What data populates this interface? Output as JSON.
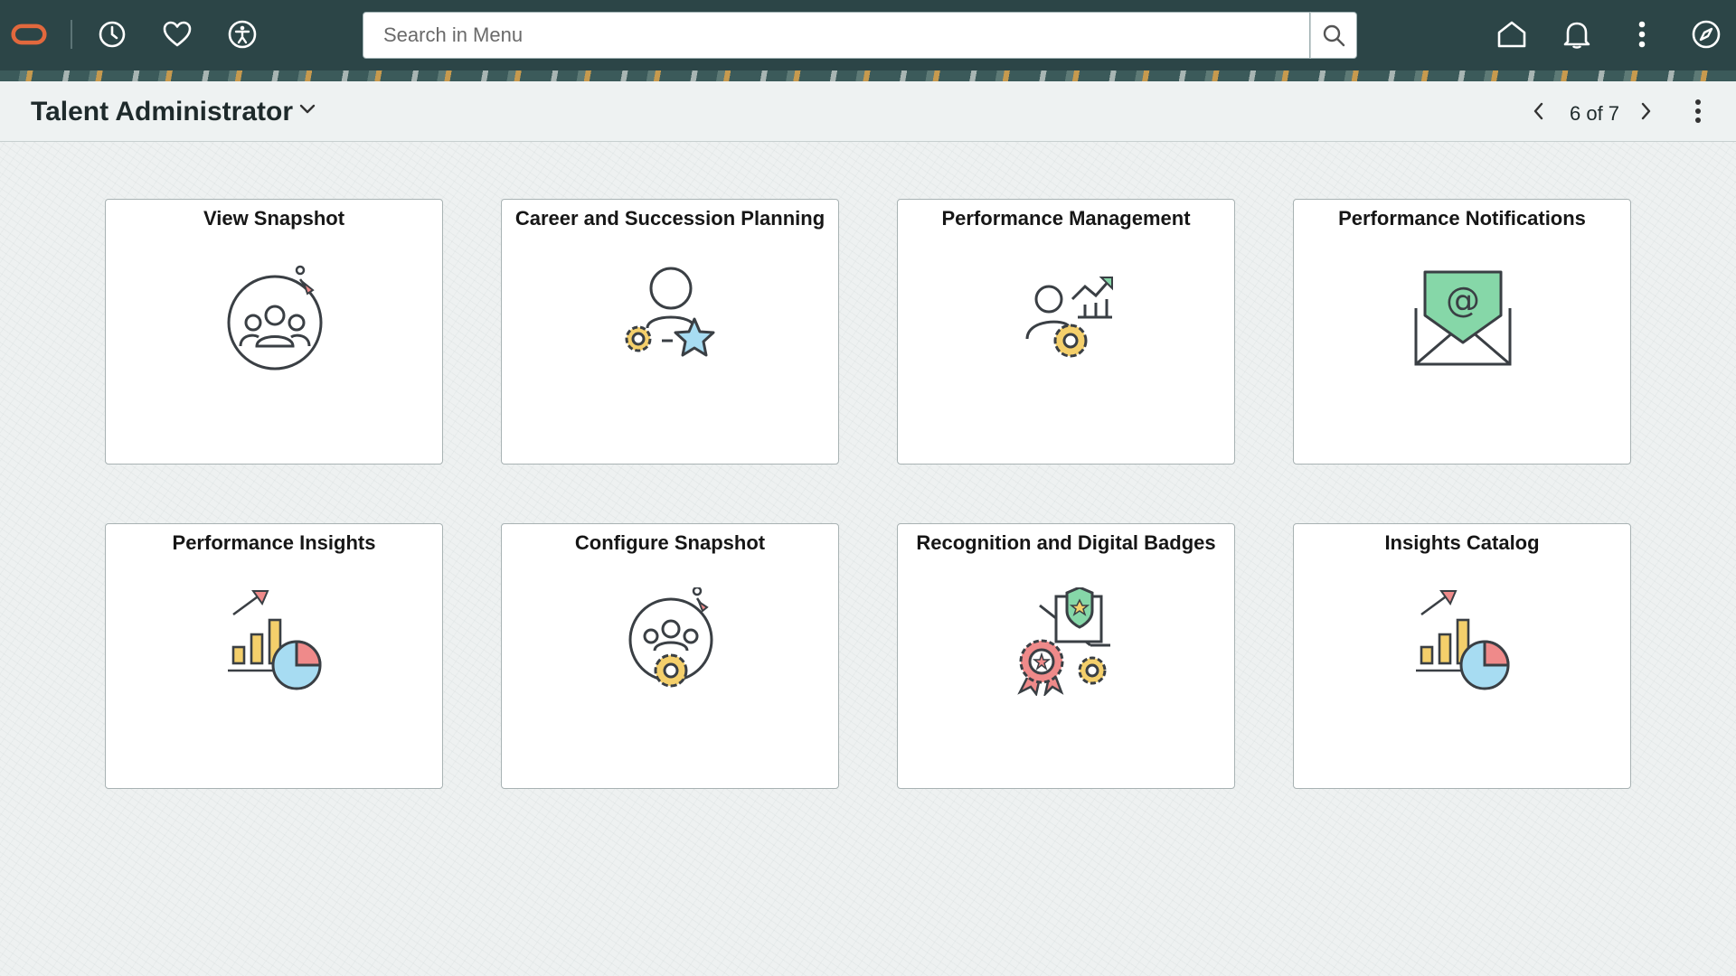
{
  "topbar": {
    "search_placeholder": "Search in Menu",
    "icons": [
      "oracle-logo",
      "recent-history-icon",
      "favorites-icon",
      "accessibility-icon",
      "search-icon",
      "home-icon",
      "notifications-icon",
      "actions-icon",
      "navigator-icon"
    ]
  },
  "page": {
    "title": "Talent Administrator",
    "pager": "6 of 7"
  },
  "tiles": [
    {
      "title": "View Snapshot",
      "icon": "team-snapshot-icon"
    },
    {
      "title": "Career and Succession Planning",
      "icon": "career-planning-icon"
    },
    {
      "title": "Performance Management",
      "icon": "performance-management-icon"
    },
    {
      "title": "Performance Notifications",
      "icon": "email-notification-icon"
    },
    {
      "title": "Performance Insights",
      "icon": "insights-chart-icon"
    },
    {
      "title": "Configure Snapshot",
      "icon": "configure-snapshot-icon"
    },
    {
      "title": "Recognition and Digital Badges",
      "icon": "badge-award-icon"
    },
    {
      "title": "Insights Catalog",
      "icon": "insights-catalog-icon"
    }
  ],
  "colors": {
    "topbar": "#2c4547",
    "accent_orange": "#c74634",
    "icon_yellow": "#f4cf6b",
    "icon_blue": "#a7dcf2",
    "icon_green": "#86d7a8",
    "icon_red": "#ef8a8a"
  }
}
